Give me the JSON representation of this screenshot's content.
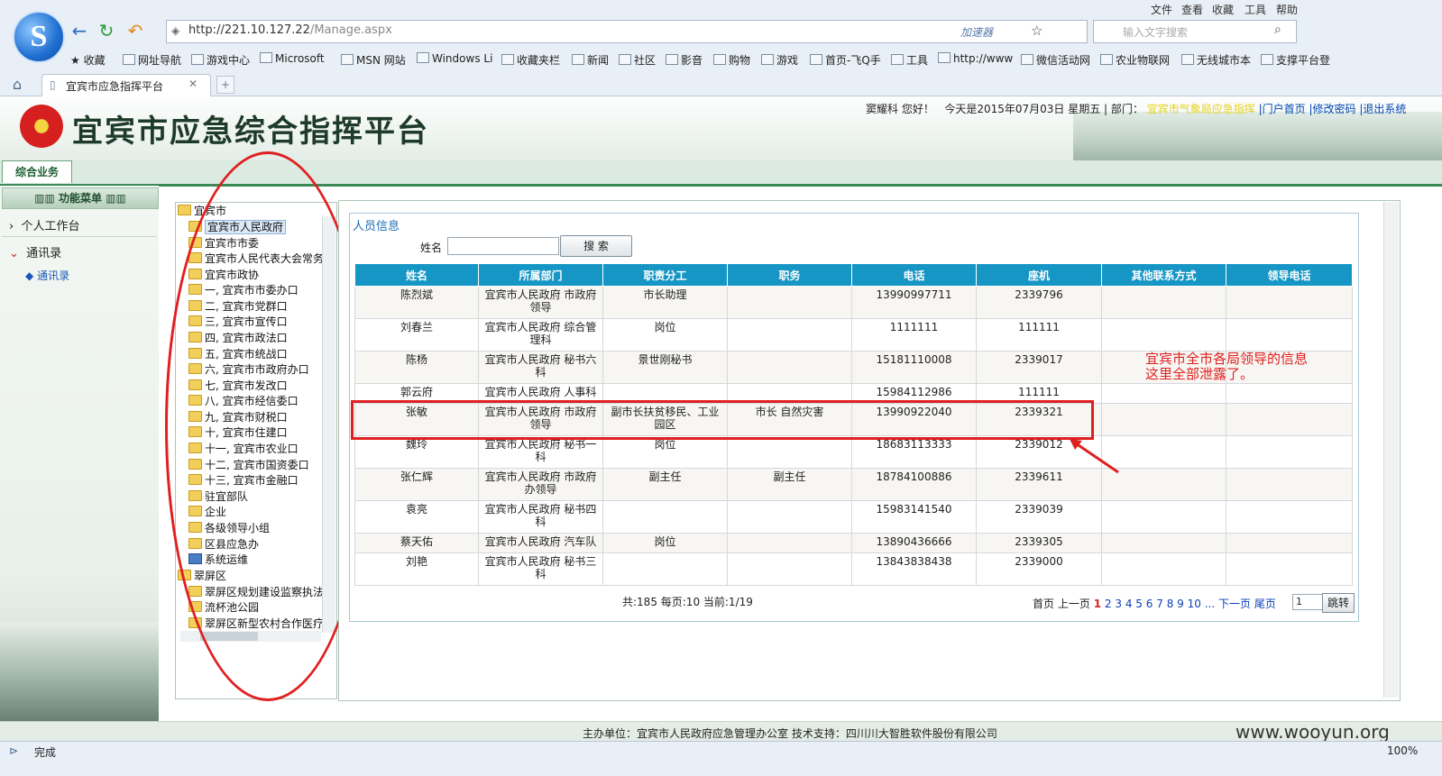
{
  "browser": {
    "top_menu": [
      "文件",
      "查看",
      "收藏",
      "工具",
      "帮助"
    ],
    "url_host": "http://221.10.127.22",
    "url_path": "/Manage.aspx",
    "accelerator": "加速器",
    "search_placeholder": "输入文字搜索",
    "favorites": [
      "收藏",
      "网址导航",
      "游戏中心",
      "Microsoft",
      "MSN 网站",
      "Windows Li",
      "收藏夹栏",
      "新闻",
      "社区",
      "影音",
      "购物",
      "游戏",
      "首页-飞Q手",
      "工具",
      "http://www",
      "微信活动网",
      "农业物联网",
      "无线城市本",
      "支撑平台登"
    ],
    "tab_title": "宜宾市应急指挥平台",
    "status_text": "完成",
    "zoom": "100%"
  },
  "app": {
    "title": "宜宾市应急综合指挥平台",
    "user": "窦耀科",
    "greeting": "您好！",
    "date_text": "今天是2015年07月03日 星期五",
    "dept_label": "| 部门：",
    "dept_value": "宜宾市气象局应急指挥",
    "links": [
      "|门户首页",
      "|修改密码",
      "|退出系统"
    ],
    "nav_tab": "综合业务",
    "menu_head": "功能菜单",
    "menu": [
      "个人工作台",
      "通讯录"
    ],
    "submenu": [
      "通讯录"
    ]
  },
  "tree": {
    "root": "宜宾市",
    "items": [
      "宜宾市人民政府",
      "宜宾市市委",
      "宜宾市人民代表大会常务",
      "宜宾市政协",
      "一, 宜宾市市委办口",
      "二, 宜宾市党群口",
      "三, 宜宾市宣传口",
      "四, 宜宾市政法口",
      "五, 宜宾市统战口",
      "六, 宜宾市市政府办口",
      "七, 宜宾市发改口",
      "八, 宜宾市经信委口",
      "九, 宜宾市财税口",
      "十, 宜宾市住建口",
      "十一, 宜宾市农业口",
      "十二, 宜宾市国资委口",
      "十三, 宜宾市金融口",
      "驻宜部队",
      "企业",
      "各级领导小组",
      "区县应急办",
      "系统运维"
    ],
    "root2": "翠屏区",
    "items2": [
      "翠屏区规划建设监察执法",
      "流杯池公园",
      "翠屏区新型农村合作医疗"
    ]
  },
  "panel": {
    "section_title": "人员信息",
    "name_label": "姓名",
    "search_button": "搜 索",
    "columns": [
      "姓名",
      "所属部门",
      "职责分工",
      "职务",
      "电话",
      "座机",
      "其他联系方式",
      "领导电话"
    ],
    "rows": [
      [
        "陈烈斌",
        "宜宾市人民政府 市政府领导",
        "市长助理",
        "",
        "13990997711",
        "2339796",
        "",
        ""
      ],
      [
        "刘春兰",
        "宜宾市人民政府 综合管理科",
        "岗位",
        "",
        "1111111",
        "111111",
        "",
        ""
      ],
      [
        "陈杨",
        "宜宾市人民政府 秘书六科",
        "景世刚秘书",
        "",
        "15181110008",
        "2339017",
        "",
        ""
      ],
      [
        "郭云府",
        "宜宾市人民政府 人事科",
        "",
        "",
        "15984112986",
        "111111",
        "",
        ""
      ],
      [
        "张敏",
        "宜宾市人民政府 市政府领导",
        "副市长扶贫移民、工业园区",
        "市长 自然灾害",
        "13990922040",
        "2339321",
        "",
        ""
      ],
      [
        "魏玲",
        "宜宾市人民政府 秘书一科",
        "岗位",
        "",
        "18683113333",
        "2339012",
        "",
        ""
      ],
      [
        "张仁辉",
        "宜宾市人民政府 市政府办领导",
        "副主任",
        "副主任",
        "18784100886",
        "2339611",
        "",
        ""
      ],
      [
        "袁亮",
        "宜宾市人民政府 秘书四科",
        "",
        "",
        "15983141540",
        "2339039",
        "",
        ""
      ],
      [
        "蔡天佑",
        "宜宾市人民政府 汽车队",
        "岗位",
        "",
        "13890436666",
        "2339305",
        "",
        ""
      ],
      [
        "刘艳",
        "宜宾市人民政府 秘书三科",
        "",
        "",
        "13843838438",
        "2339000",
        "",
        ""
      ]
    ],
    "page_info": "共:185  每页:10  当前:1/19",
    "pager_first": "首页",
    "pager_prev": "上一页",
    "pages": [
      "1",
      "2",
      "3",
      "4",
      "5",
      "6",
      "7",
      "8",
      "9",
      "10",
      "..."
    ],
    "pager_next": "下一页",
    "pager_last": "尾页",
    "page_input": "1",
    "go_button": "跳转"
  },
  "annotation": {
    "line1": "宜宾市全市各局领导的信息",
    "line2": "这里全部泄露了。"
  },
  "footer": {
    "text": "主办单位：宜宾市人民政府应急管理办公室  技术支持：四川川大智胜软件股份有限公司",
    "watermark": "www.wooyun.org"
  }
}
